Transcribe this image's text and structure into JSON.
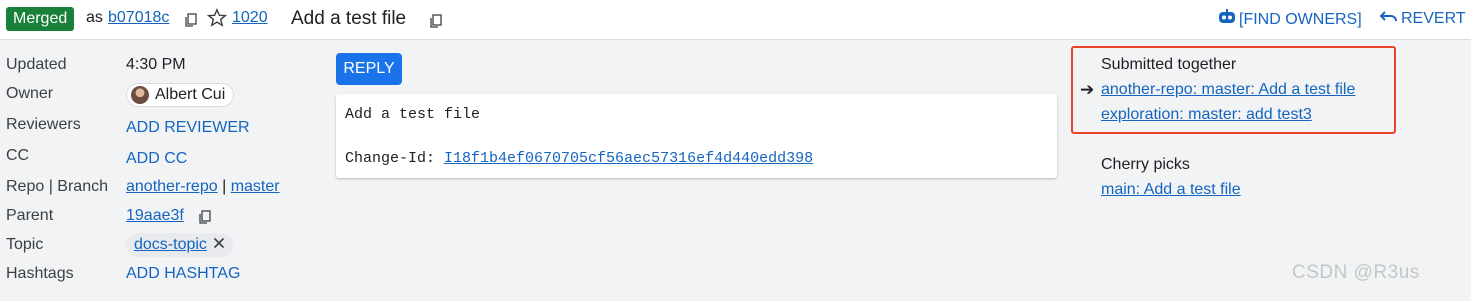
{
  "header": {
    "status_badge": "Merged",
    "as_text": "as",
    "commit_hash": "b07018c",
    "change_number": "1020",
    "subject": "Add a test file",
    "find_owners": "[FIND OWNERS]",
    "revert": "REVERT"
  },
  "metadata": {
    "updated_label": "Updated",
    "updated_value": "4:30 PM",
    "owner_label": "Owner",
    "owner_name": "Albert Cui",
    "reviewers_label": "Reviewers",
    "add_reviewer": "ADD REVIEWER",
    "cc_label": "CC",
    "add_cc": "ADD CC",
    "repo_branch_label": "Repo | Branch",
    "repo": "another-repo",
    "separator": "|",
    "branch": "master",
    "parent_label": "Parent",
    "parent_hash": "19aae3f",
    "topic_label": "Topic",
    "topic": "docs-topic",
    "hashtags_label": "Hashtags",
    "add_hashtag": "ADD HASHTAG"
  },
  "message": {
    "reply_button": "REPLY",
    "line1": "Add a test file",
    "change_id_label": "Change-Id:",
    "change_id": "I18f1b4ef0670705cf56aec57316ef4d440edd398"
  },
  "related": {
    "submitted_together_heading": "Submitted together",
    "current_marker": "➔",
    "submitted_items": [
      "another-repo: master: Add a test file",
      "exploration: master: add test3"
    ],
    "cherry_picks_heading": "Cherry picks",
    "cherry_pick_items": [
      "main: Add a test file"
    ]
  },
  "watermark": "CSDN @R3us",
  "colors": {
    "merged": "#188038",
    "link": "#1565c0",
    "reply": "#1a73e8",
    "highlight": "#e8442b"
  }
}
